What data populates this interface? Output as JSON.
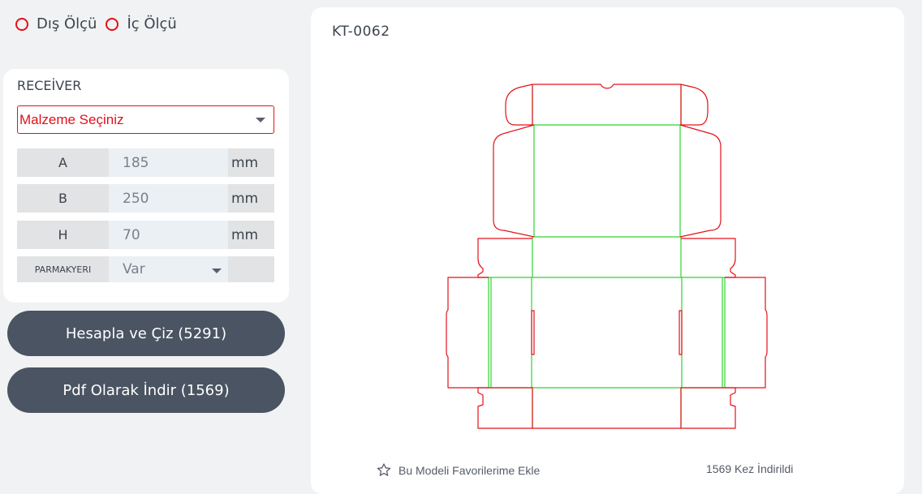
{
  "measure_options": [
    {
      "label": "Dış Ölçü",
      "selected": false
    },
    {
      "label": "İç Ölçü",
      "selected": false
    }
  ],
  "product": {
    "name": "RECEİVER",
    "material_select": "Malzeme Seçiniz",
    "dimensions": [
      {
        "label": "A",
        "value": "185",
        "unit": "mm"
      },
      {
        "label": "B",
        "value": "250",
        "unit": "mm"
      },
      {
        "label": "H",
        "value": "70",
        "unit": "mm"
      }
    ],
    "finger_hole": {
      "label": "PARMAKYERI",
      "value": "Var"
    }
  },
  "buttons": {
    "calculate": "Hesapla ve Çiz (5291)",
    "pdf": "Pdf Olarak İndir (1569)"
  },
  "preview": {
    "model_code": "KT-0062",
    "favorite_label": "Bu Modeli Favorilerime Ekle",
    "download_count": "1569 Kez İndirildi"
  },
  "colors": {
    "cut_line": "#e3101a",
    "fold_line": "#2fd42f",
    "button_bg": "#4a5462",
    "accent": "#e3101a"
  }
}
